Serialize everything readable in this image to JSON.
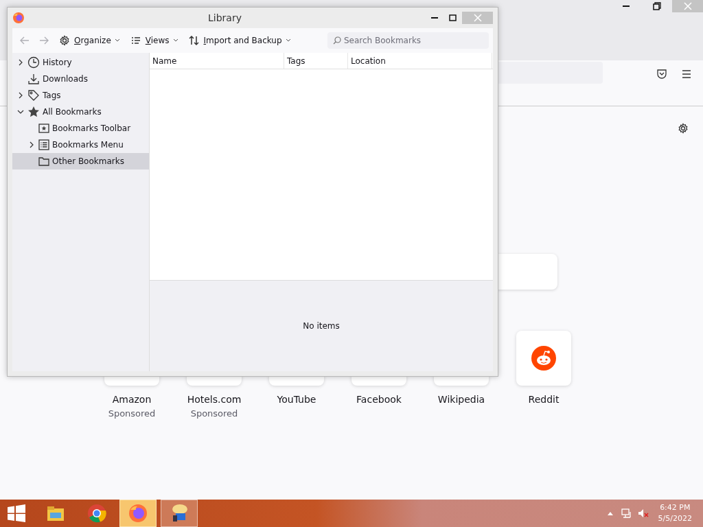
{
  "browser": {
    "new_tab": {
      "tiles": [
        {
          "title": "Amazon",
          "subtitle": "Sponsored",
          "kind": "plain"
        },
        {
          "title": "Hotels.com",
          "subtitle": "Sponsored",
          "kind": "plain"
        },
        {
          "title": "YouTube",
          "kind": "plain"
        },
        {
          "title": "Facebook",
          "kind": "plain"
        },
        {
          "title": "Wikipedia",
          "kind": "plain"
        },
        {
          "title": "Reddit",
          "kind": "reddit"
        }
      ]
    }
  },
  "library": {
    "title": "Library",
    "toolbar": {
      "back": {
        "disabled": true
      },
      "forward": {
        "disabled": true
      },
      "menus": [
        {
          "label": "Organize",
          "kind": "gear"
        },
        {
          "label": "Views",
          "kind": "list"
        },
        {
          "label": "Import and Backup",
          "kind": "sort"
        }
      ],
      "search": {
        "placeholder": "Search Bookmarks"
      }
    },
    "tree": [
      {
        "label": "History",
        "kind": "clock",
        "expanded": false,
        "selected": false
      },
      {
        "label": "Downloads",
        "kind": "download",
        "selected": false
      },
      {
        "label": "Tags",
        "kind": "tag",
        "expanded": false,
        "selected": false
      },
      {
        "label": "All Bookmarks",
        "kind": "star",
        "expanded": true,
        "selected": false,
        "children": [
          {
            "label": "Bookmarks Toolbar",
            "kind": "toolbar",
            "selected": false
          },
          {
            "label": "Bookmarks Menu",
            "kind": "menu",
            "expanded": false,
            "selected": false
          },
          {
            "label": "Other Bookmarks",
            "kind": "folder",
            "selected": true
          }
        ]
      }
    ],
    "columns": [
      "Name",
      "Tags",
      "Location"
    ],
    "details": "No items"
  },
  "taskbar": {
    "apps": [
      {
        "kind": "explorer",
        "running": false,
        "selected": false
      },
      {
        "kind": "chrome",
        "running": false,
        "selected": false
      },
      {
        "kind": "firefox",
        "running": true,
        "selected": true
      },
      {
        "kind": "messenger",
        "running": true,
        "selected": false
      }
    ],
    "time": "6:42 PM",
    "date": "5/5/2022"
  }
}
